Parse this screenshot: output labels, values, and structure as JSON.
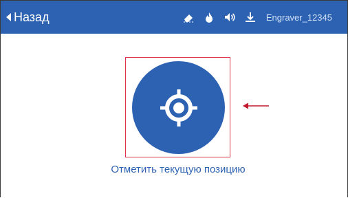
{
  "header": {
    "back_label": "Назад",
    "device_name": "Engraver_12345",
    "status_icons": [
      "eraser-icon",
      "flame-icon",
      "speaker-icon",
      "download-icon"
    ]
  },
  "main": {
    "mark_position_label": "Отметить текущую позицию",
    "target_icon": "crosshair-icon"
  },
  "colors": {
    "header_bg": "#2d62b3",
    "button_bg": "#2d62b3",
    "highlight_box": "#e0304a",
    "arrow": "#c0182c",
    "label_text": "#2d62b3"
  }
}
